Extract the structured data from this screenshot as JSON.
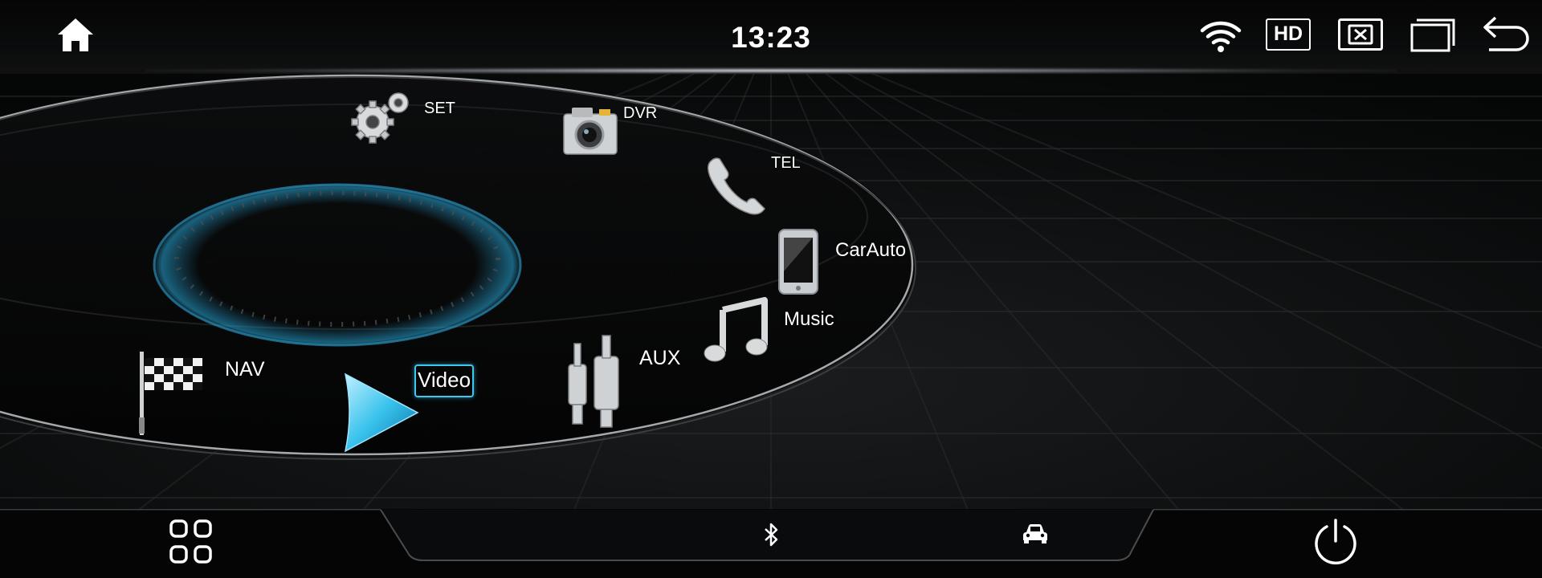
{
  "status_bar": {
    "time": "13:23",
    "hd_label": "HD"
  },
  "apps": [
    {
      "id": "set",
      "label": "SET",
      "icon": "gear-icon"
    },
    {
      "id": "dvr",
      "label": "DVR",
      "icon": "camera-icon"
    },
    {
      "id": "tel",
      "label": "TEL",
      "icon": "phone-icon"
    },
    {
      "id": "carauto",
      "label": "CarAuto",
      "icon": "smartphone-icon"
    },
    {
      "id": "music",
      "label": "Music",
      "icon": "music-note-icon"
    },
    {
      "id": "aux",
      "label": "AUX",
      "icon": "aux-cable-icon"
    },
    {
      "id": "video",
      "label": "Video",
      "icon": "play-icon",
      "selected": true
    },
    {
      "id": "nav",
      "label": "NAV",
      "icon": "checkered-flag-icon"
    }
  ],
  "dock": {
    "items": [
      "apps-grid-icon",
      "bluetooth-icon",
      "car-icon",
      "power-icon"
    ]
  },
  "colors": {
    "accent": "#3fc7ee",
    "background": "#060708",
    "text": "#ffffff"
  }
}
